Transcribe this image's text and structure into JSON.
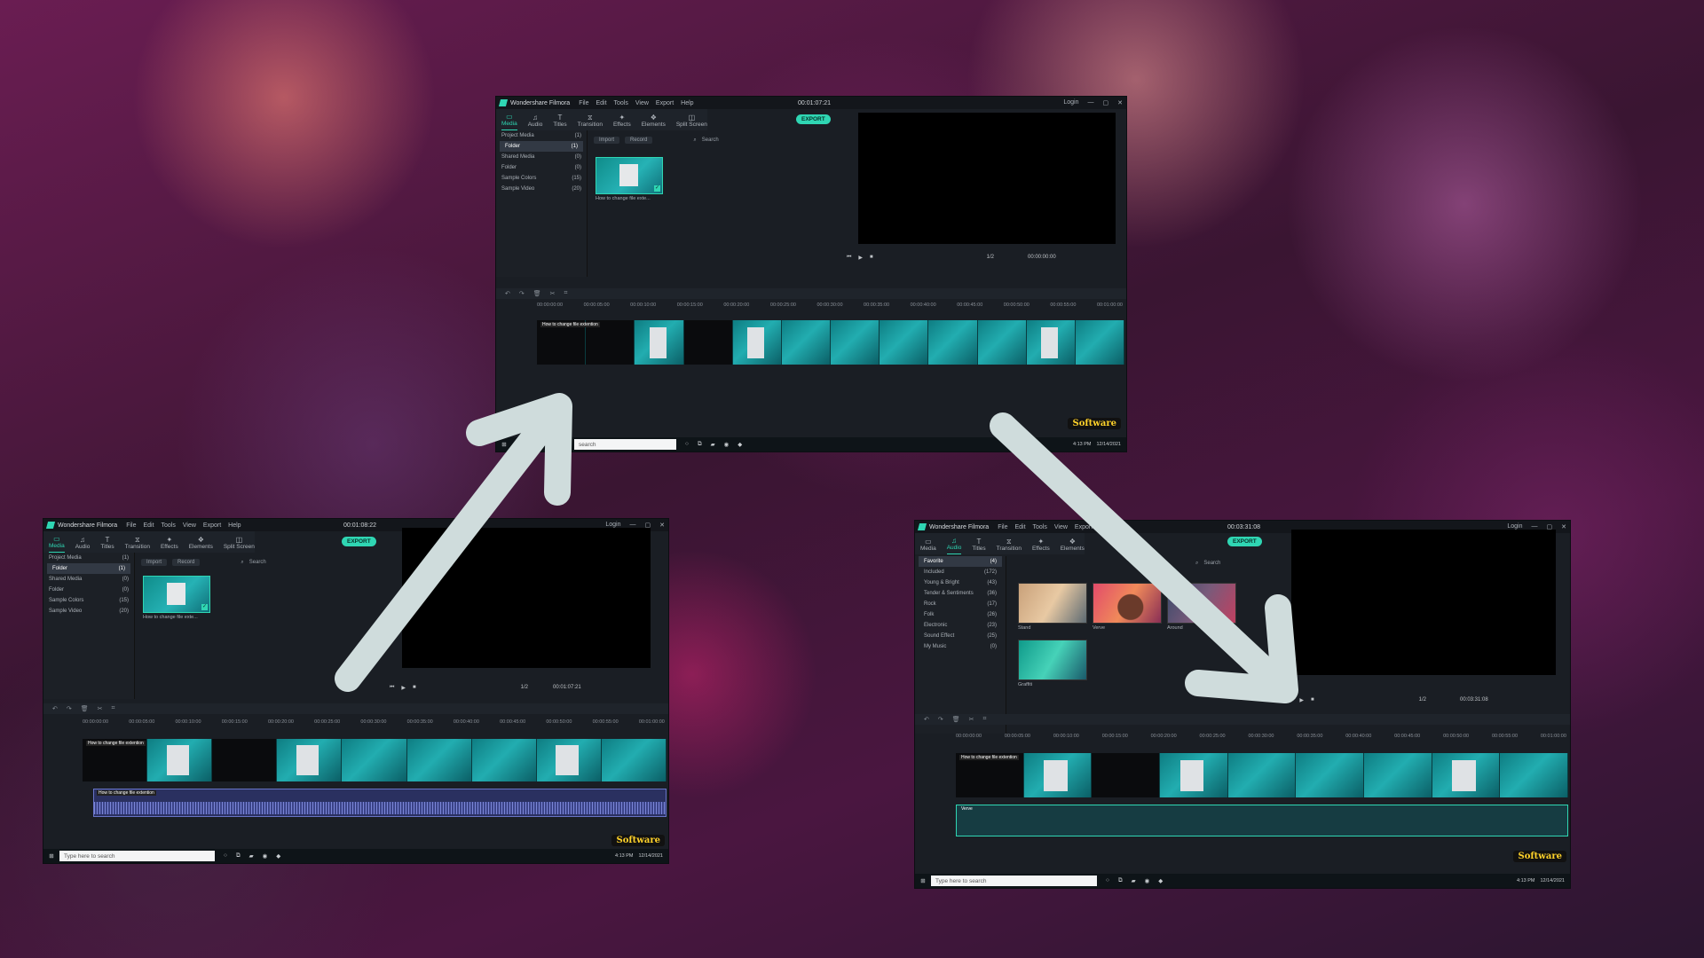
{
  "app": {
    "name": "Wondershare Filmora",
    "menu": [
      "File",
      "Edit",
      "Tools",
      "View",
      "Export",
      "Help"
    ],
    "login": "Login",
    "export_label": "EXPORT",
    "search_placeholder": "Search",
    "watermark": "Software"
  },
  "toolbar_tabs": [
    {
      "label": "Media",
      "icon": "folder-icon"
    },
    {
      "label": "Audio",
      "icon": "music-note-icon"
    },
    {
      "label": "Titles",
      "icon": "text-icon"
    },
    {
      "label": "Transition",
      "icon": "transition-icon"
    },
    {
      "label": "Effects",
      "icon": "effects-icon"
    },
    {
      "label": "Elements",
      "icon": "elements-icon"
    },
    {
      "label": "Split Screen",
      "icon": "split-screen-icon"
    }
  ],
  "media_panel": {
    "items": [
      {
        "label": "Project Media",
        "count": "(1)"
      },
      {
        "label": "Folder",
        "count": "(1)"
      },
      {
        "label": "Shared Media",
        "count": "(0)"
      },
      {
        "label": "Folder",
        "count": "(0)"
      },
      {
        "label": "Sample Colors",
        "count": "(15)"
      },
      {
        "label": "Sample Video",
        "count": "(20)"
      }
    ],
    "import_label": "Import",
    "record_label": "Record",
    "thumb_caption": "How to change file exte..."
  },
  "audio_panel": {
    "items": [
      {
        "label": "Favorite",
        "count": "(4)"
      },
      {
        "label": "Included",
        "count": "(172)"
      },
      {
        "label": "Young & Bright",
        "count": "(43)"
      },
      {
        "label": "Tender & Sentiments",
        "count": "(36)"
      },
      {
        "label": "Rock",
        "count": "(17)"
      },
      {
        "label": "Folk",
        "count": "(26)"
      },
      {
        "label": "Electronic",
        "count": "(23)"
      },
      {
        "label": "Sound Effect",
        "count": "(25)"
      },
      {
        "label": "My Music",
        "count": "(0)"
      }
    ],
    "thumbs": [
      "Stand",
      "Verve",
      "Around",
      "Graffiti"
    ]
  },
  "timeline": {
    "clip_label": "How to change file extention",
    "music_clip_label": "Verve",
    "ruler": [
      "00:00:00:00",
      "00:00:05:00",
      "00:00:10:00",
      "00:00:15:00",
      "00:00:20:00",
      "00:00:25:00",
      "00:00:30:00",
      "00:00:35:00",
      "00:00:40:00",
      "00:00:45:00",
      "00:00:50:00",
      "00:00:55:00",
      "00:01:00:00"
    ]
  },
  "screens": {
    "top": {
      "timecode": "00:01:07:21",
      "preview_time": "00:00:00:00",
      "ratio": "1/2",
      "search_text": "search",
      "clock_time": "4:13 PM",
      "clock_date": "12/14/2021"
    },
    "left": {
      "timecode": "00:01:08:22",
      "preview_time": "00:01:07:21",
      "ratio": "1/2",
      "search_text": "Type here to search",
      "clock_time": "4:13 PM",
      "clock_date": "12/14/2021"
    },
    "right": {
      "timecode": "00:03:31:08",
      "preview_time": "00:03:31:08",
      "ratio": "1/2",
      "search_text": "Type here to search",
      "clock_time": "4:13 PM",
      "clock_date": "12/14/2021"
    }
  },
  "colors": {
    "accent": "#2fd6b3",
    "arrow": "#cfdcdc",
    "watermark": "#ffd22a"
  }
}
